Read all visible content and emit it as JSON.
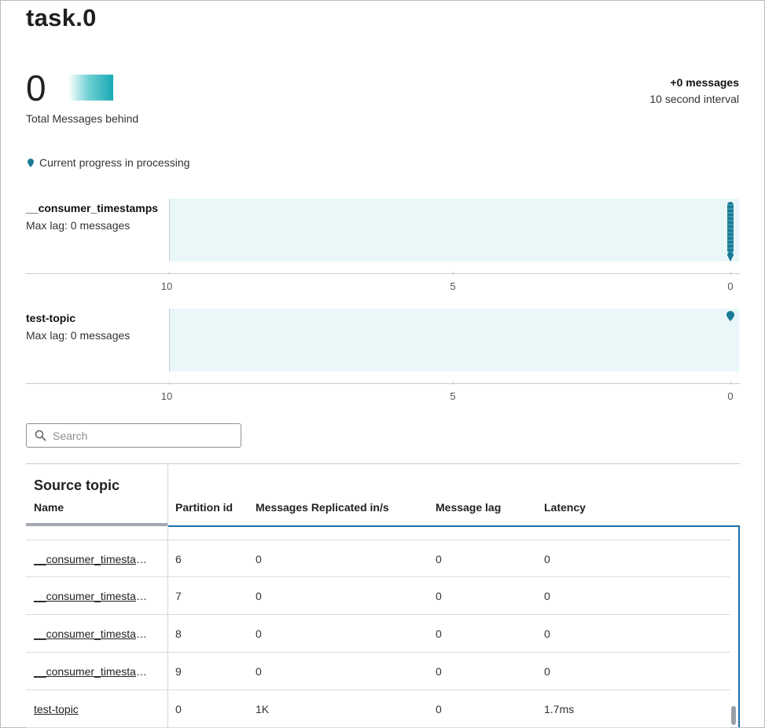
{
  "page": {
    "title": "task.0"
  },
  "summary": {
    "total_value": "0",
    "total_label": "Total Messages behind",
    "delta": "+0 messages",
    "interval": "10 second interval"
  },
  "legend": {
    "label": "Current progress in processing",
    "icon": "map-pin-icon",
    "color": "#1c7a94"
  },
  "topics": [
    {
      "name": "__consumer_timestamps",
      "max_lag": "Max lag: 0 messages"
    },
    {
      "name": "test-topic",
      "max_lag": "Max lag: 0 messages"
    }
  ],
  "axis_ticks": [
    "10",
    "5",
    "0"
  ],
  "search": {
    "placeholder": "Search",
    "icon": "search-icon"
  },
  "table": {
    "group_title": "Source topic",
    "columns": [
      "Name",
      "Partition id",
      "Messages Replicated in/s",
      "Message lag",
      "Latency"
    ],
    "rows": [
      {
        "name": "__consumer_timestamps",
        "partition": "6",
        "replicated": "0",
        "lag": "0",
        "latency": "0"
      },
      {
        "name": "__consumer_timestamps",
        "partition": "7",
        "replicated": "0",
        "lag": "0",
        "latency": "0"
      },
      {
        "name": "__consumer_timestamps",
        "partition": "8",
        "replicated": "0",
        "lag": "0",
        "latency": "0"
      },
      {
        "name": "__consumer_timestamps",
        "partition": "9",
        "replicated": "0",
        "lag": "0",
        "latency": "0"
      },
      {
        "name": "test-topic",
        "partition": "0",
        "replicated": "1K",
        "lag": "0",
        "latency": "1.7ms"
      }
    ]
  },
  "colors": {
    "accent": "#1f6fa8",
    "lag_fill": "#e9f7f8",
    "gradient_end": "#17a9b4"
  }
}
